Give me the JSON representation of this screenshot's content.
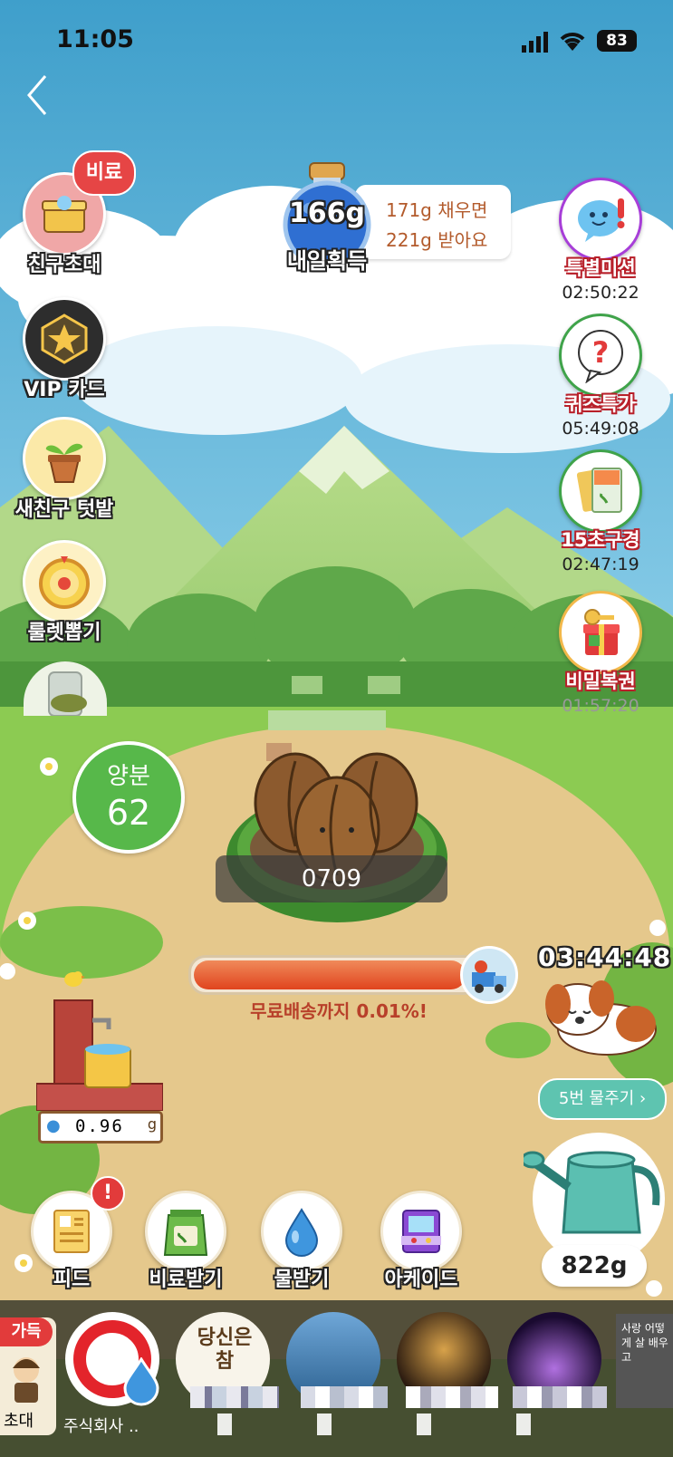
{
  "status_bar": {
    "time": "11:05",
    "battery": "83"
  },
  "fertilizer_jar": {
    "amount": "166g",
    "label": "내일획득",
    "tip_line1": "171g 채우면",
    "tip_line2": "221g 받아요"
  },
  "left_menu": [
    {
      "label": "친구초대",
      "badge": "비료",
      "icon": "gift-chest-icon"
    },
    {
      "label": "VIP 카드",
      "icon": "star-badge-icon"
    },
    {
      "label": "새친구 텃밭",
      "icon": "plant-pot-icon"
    },
    {
      "label": "룰렛뽑기",
      "icon": "roulette-icon"
    }
  ],
  "right_menu": [
    {
      "label": "특별미션",
      "timer": "02:50:22",
      "icon": "chat-face-icon"
    },
    {
      "label": "퀴즈특가",
      "timer": "05:49:08",
      "icon": "question-bubble-icon"
    },
    {
      "label": "15초구경",
      "timer": "02:47:19",
      "icon": "seed-packet-icon"
    },
    {
      "label": "비밀복권",
      "timer": "01:57:20",
      "icon": "key-giftbox-icon"
    }
  ],
  "nutrient": {
    "label": "양분",
    "value": "62"
  },
  "crop": {
    "code": "0709"
  },
  "progress": {
    "value": 0.9999,
    "text": "무료배송까지 0.01%!"
  },
  "dog_timer": "03:44:48",
  "water_tank": {
    "amount": "0.96",
    "unit": "g"
  },
  "water_button": "5번 물주기",
  "watering_can": {
    "amount": "822g"
  },
  "bottom_menu": [
    {
      "label": "피드",
      "icon": "feed-icon",
      "alert": "!"
    },
    {
      "label": "비료받기",
      "icon": "fertilizer-bag-icon"
    },
    {
      "label": "물받기",
      "icon": "water-drop-icon"
    },
    {
      "label": "아케이드",
      "icon": "arcade-icon"
    }
  ],
  "stories": {
    "first_badge": "가득",
    "first_label": "초대",
    "company_label": "주식회사 ..",
    "story_text": "당신은 참",
    "story_text2": "사랑 어떻게 살 배우고"
  },
  "colors": {
    "sky": "#4aa6cf",
    "grass": "#8cc54a",
    "dirt": "#e2c68b",
    "progress": "#e8552b",
    "teal_button": "#5ec4b0"
  }
}
